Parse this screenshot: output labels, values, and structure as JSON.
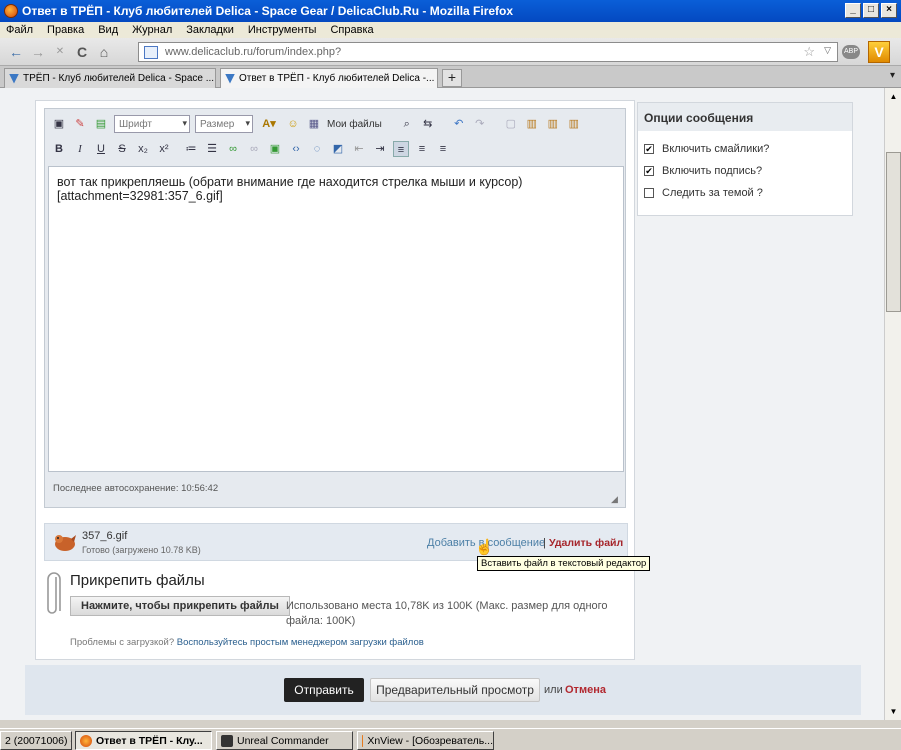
{
  "window": {
    "title": "Ответ в ТРЁП - Клуб любителей Delica - Space Gear / DelicaClub.Ru - Mozilla Firefox",
    "controls": {
      "minimize": "_",
      "maximize": "□",
      "close": "×"
    }
  },
  "menu": [
    "Файл",
    "Правка",
    "Вид",
    "Журнал",
    "Закладки",
    "Инструменты",
    "Справка"
  ],
  "nav": {
    "back": "←",
    "forward": "→",
    "reload": "C",
    "home": "⌂",
    "url": "www.delicaclub.ru/forum/index.php?",
    "star": "☆",
    "dropdown": "▽",
    "addon_badge": "ABP",
    "addon_logo": "V"
  },
  "tabs": [
    {
      "label": "ТРЁП - Клуб любителей Delica - Space ...",
      "active": false
    },
    {
      "label": "Ответ в ТРЁП - Клуб любителей Delica -...",
      "active": true
    }
  ],
  "new_tab": "+",
  "editor": {
    "font_select": "Шрифт",
    "size_select": "Размер",
    "my_files": "Мои файлы",
    "format_buttons": {
      "bold": "B",
      "italic": "I",
      "underline": "U",
      "strike": "S",
      "sub": "x₂",
      "sup": "x²"
    },
    "text_line1": "вот так прикрепляешь (обрати внимание где находится стрелка мыши и курсор)",
    "text_line2": "[attachment=32981:357_6.gif]",
    "autosave": "Последнее автосохранение: 10:56:42"
  },
  "attachment": {
    "filename": "357_6.gif",
    "status": "Готово (загружено 10.78 KB)",
    "add_link": "Добавить в сообщение",
    "separator": "|",
    "delete_link": "Удалить файл",
    "tooltip": "Вставить файл в текстовый редактор"
  },
  "attach_files": {
    "title": "Прикрепить файлы",
    "button": "Нажмите, чтобы прикрепить файлы",
    "usage": "Использовано места 10,78K из 100K (Макс. размер для одного файла: 100K)",
    "problems_text": "Проблемы с загрузкой?",
    "problems_link": "Воспользуйтесь простым менеджером загрузки файлов"
  },
  "options": {
    "title": "Опции сообщения",
    "items": [
      {
        "label": "Включить смайлики?",
        "checked": true
      },
      {
        "label": "Включить подпись?",
        "checked": true
      },
      {
        "label": "Следить за темой ?",
        "checked": false
      }
    ]
  },
  "footer": {
    "send": "Отправить",
    "preview": "Предварительный просмотр",
    "or": "или",
    "cancel": "Отмена"
  },
  "taskbar": [
    {
      "label": "2 (20071006) - ...",
      "active": false
    },
    {
      "label": "Ответ в ТРЁП - Клу...",
      "active": true
    },
    {
      "label": "Unreal Commander",
      "active": false
    },
    {
      "label": "XnView - [Обозреватель...",
      "active": false
    }
  ],
  "colors": {
    "accent": "#0a5fd8",
    "link": "#4b7fa6",
    "danger": "#a6262c",
    "send_button": "#222222"
  }
}
